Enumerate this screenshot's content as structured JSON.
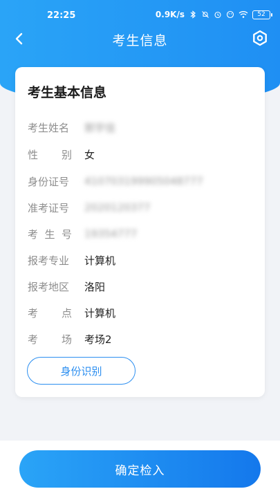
{
  "status": {
    "time": "22:25",
    "speed": "0.9K/s",
    "battery": "52"
  },
  "nav": {
    "title": "考生信息",
    "back_icon": "chevron-left-icon",
    "settings_icon": "settings-icon"
  },
  "card": {
    "title": "考生基本信息",
    "rows": [
      {
        "label": "考生姓名",
        "value": "郭宇佳",
        "blurred": true
      },
      {
        "label": "性别",
        "value": "女",
        "blurred": false
      },
      {
        "label": "身份证号",
        "value": "410703199905048777",
        "blurred": true
      },
      {
        "label": "准考证号",
        "value": "2020120377",
        "blurred": true
      },
      {
        "label": "考生号",
        "value": "19354777",
        "blurred": true
      },
      {
        "label": "报考专业",
        "value": "计算机",
        "blurred": false
      },
      {
        "label": "报考地区",
        "value": "洛阳",
        "blurred": false
      },
      {
        "label": "考点",
        "value": "计算机",
        "blurred": false
      },
      {
        "label": "考场",
        "value": "考场2",
        "blurred": false
      }
    ],
    "id_button": "身份识别"
  },
  "footer": {
    "confirm_button": "确定检入"
  },
  "colors": {
    "primary": "#1f8ff3",
    "label": "#8d8d8d",
    "background": "#f1f3f7"
  }
}
